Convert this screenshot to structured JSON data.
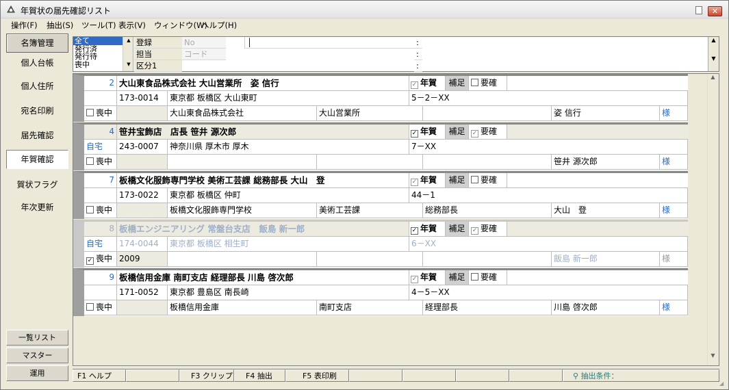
{
  "window": {
    "title": "年賀状の届先確認リスト",
    "close": "✕"
  },
  "menu": [
    "操作(F)",
    "抽出(S)",
    "ツール(T)",
    "表示(V)",
    "ウィンドウ(W)",
    "ヘルプ(H)"
  ],
  "sidebar": {
    "items": [
      "名簿管理",
      "個人台帳",
      "個人住所",
      "宛名印刷",
      "届先確認",
      "年賀確認",
      "賀状フラグ",
      "年次更新"
    ],
    "bottom": [
      "一覧リスト",
      "マスター",
      "運用"
    ]
  },
  "filter": {
    "options": [
      "全て",
      "発行済",
      "発行待",
      "喪中"
    ],
    "row1": {
      "label": "登録",
      "field": "No"
    },
    "row2": {
      "label": "担当",
      "field": "コード"
    },
    "row3": {
      "label": "区分1"
    },
    "colon": ":"
  },
  "labels": {
    "nenga": "年賀",
    "hosoku": "補足",
    "youkaku": "要確",
    "mochu": "喪中",
    "sama": "様",
    "jitaku": "自宅"
  },
  "records": [
    {
      "no": "2",
      "name": "大山東食品株式会社 大山営業所　姿 信行",
      "zip": "173-0014",
      "addr1": "東京都 板橋区 大山東町",
      "addr2": "5－2－XX",
      "company": "大山東食品株式会社",
      "dept": "大山営業所",
      "title": "",
      "person": "姿 信行",
      "year": "",
      "home": ""
    },
    {
      "no": "4",
      "name": "笹井宝飾店　店長 笹井 源次郎",
      "zip": "243-0007",
      "addr1": "神奈川県 厚木市 厚木",
      "addr2": "7－XX",
      "company": "",
      "dept": "",
      "title": "",
      "person": "笹井 源次郎",
      "year": "",
      "home": "自宅"
    },
    {
      "no": "7",
      "name": "板橋文化服飾専門学校 美術工芸課 総務部長 大山　登",
      "zip": "173-0022",
      "addr1": "東京都 板橋区 仲町",
      "addr2": "44－1",
      "company": "板橋文化服飾専門学校",
      "dept": "美術工芸課",
      "title": "総務部長",
      "person": "大山　登",
      "year": "",
      "home": ""
    },
    {
      "no": "8",
      "name": "板橋エンジニアリング 常盤台支店　飯島 新一郎",
      "zip": "174-0044",
      "addr1": "東京都 板橋区 相生町",
      "addr2": "6－XX",
      "company": "",
      "dept": "",
      "title": "",
      "person": "飯島 新一郎",
      "year": "2009",
      "home": "自宅"
    },
    {
      "no": "9",
      "name": "板橋信用金庫 南町支店 経理部長 川島 啓次郎",
      "zip": "171-0052",
      "addr1": "東京都 豊島区 南長崎",
      "addr2": "4－5－XX",
      "company": "板橋信用金庫",
      "dept": "南町支店",
      "title": "経理部長",
      "person": "川島 啓次郎",
      "year": "",
      "home": ""
    }
  ],
  "statusbar": {
    "f1": "F1 ヘルプ",
    "f3": "F3 クリップ",
    "f4": "F4 抽出",
    "f5": "F5 表印刷",
    "cond": "抽出条件："
  }
}
